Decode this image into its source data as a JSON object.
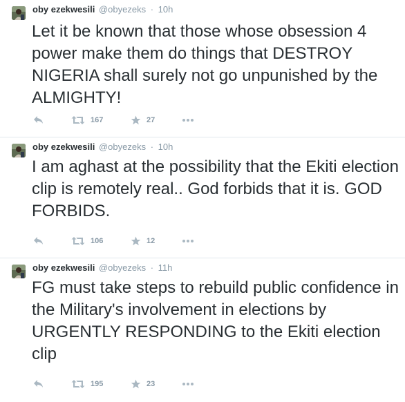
{
  "tweets": [
    {
      "fullname": "oby ezekwesili",
      "username": "@obyezeks",
      "time": "10h",
      "text": "Let it be known that those whose obsession 4 power make them do things that DESTROY NIGERIA shall surely not go unpunished by the ALMIGHTY!",
      "retweets": "167",
      "favorites": "27"
    },
    {
      "fullname": "oby ezekwesili",
      "username": "@obyezeks",
      "time": "10h",
      "text": "I am aghast at the possibility that the Ekiti election clip is remotely real.. God forbids that it is. GOD FORBIDS.",
      "retweets": "106",
      "favorites": "12"
    },
    {
      "fullname": "oby ezekwesili",
      "username": "@obyezeks",
      "time": "11h",
      "text": "FG must take steps to rebuild public confidence in the Military's involvement in elections by URGENTLY RESPONDING to the Ekiti election clip",
      "retweets": "195",
      "favorites": "23"
    }
  ],
  "separator": "·",
  "icons": {
    "reply": "reply-icon",
    "retweet": "retweet-icon",
    "favorite": "star-icon",
    "more": "more-dots-icon"
  },
  "colors": {
    "text": "#292f33",
    "muted": "#8899a6",
    "icon": "#aab8c2",
    "border": "#e1e8ed"
  }
}
